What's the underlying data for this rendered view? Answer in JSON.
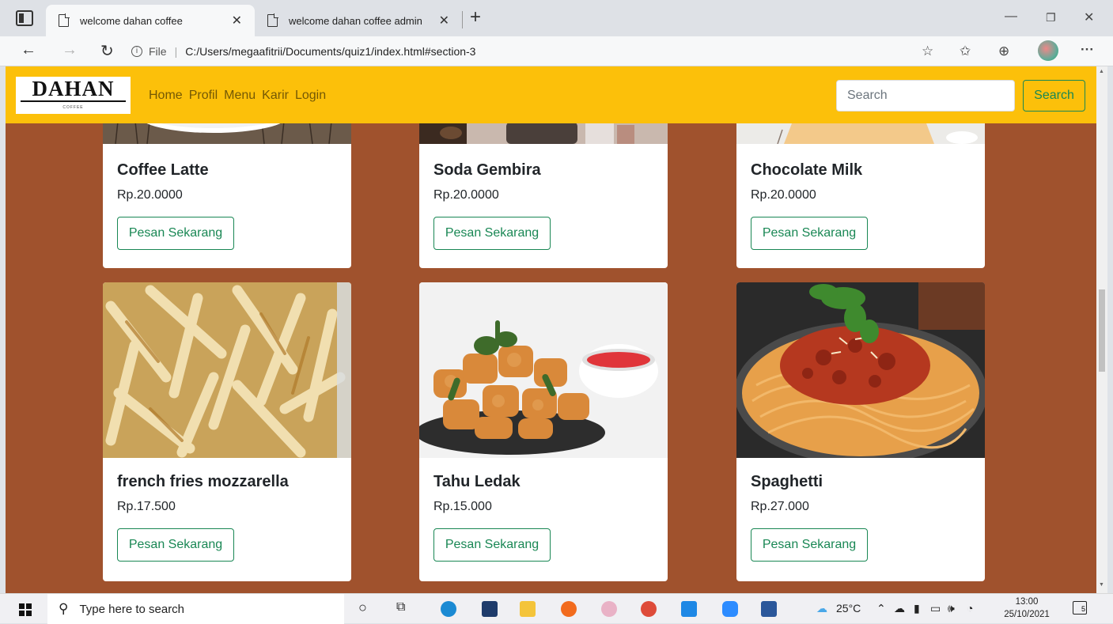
{
  "browser": {
    "tabs": [
      {
        "title": "welcome dahan coffee",
        "active": true
      },
      {
        "title": "welcome dahan coffee admin",
        "active": false
      }
    ],
    "address": {
      "scheme_label": "File",
      "url": "C:/Users/megaafitrii/Documents/quiz1/index.html#section-3"
    }
  },
  "site": {
    "brand": {
      "name": "DAHAN",
      "tagline": "COFFEE"
    },
    "nav": [
      "Home",
      "Profil",
      "Menu",
      "Karir",
      "Login"
    ],
    "search": {
      "placeholder": "Search",
      "button_label": "Search"
    },
    "menu_items": [
      {
        "name": "Coffee Latte",
        "price": "Rp.20.0000",
        "button": "Pesan Sekarang",
        "image": "coffee-latte-photo"
      },
      {
        "name": "Soda Gembira",
        "price": "Rp.20.0000",
        "button": "Pesan Sekarang",
        "image": "soda-gembira-photo"
      },
      {
        "name": "Chocolate Milk",
        "price": "Rp.20.0000",
        "button": "Pesan Sekarang",
        "image": "chocolate-milk-photo"
      },
      {
        "name": "french fries mozzarella",
        "price": "Rp.17.500",
        "button": "Pesan Sekarang",
        "image": "french-fries-photo"
      },
      {
        "name": "Tahu Ledak",
        "price": "Rp.15.000",
        "button": "Pesan Sekarang",
        "image": "tahu-ledak-photo"
      },
      {
        "name": "Spaghetti",
        "price": "Rp.27.000",
        "button": "Pesan Sekarang",
        "image": "spaghetti-photo"
      }
    ],
    "colors": {
      "navbar": "#fcc00a",
      "page_bg": "#a0522d",
      "success": "#198754"
    }
  },
  "taskbar": {
    "search_placeholder": "Type here to search",
    "weather": "25°C",
    "time": "13:00",
    "date": "25/10/2021",
    "notification_count": "5"
  }
}
